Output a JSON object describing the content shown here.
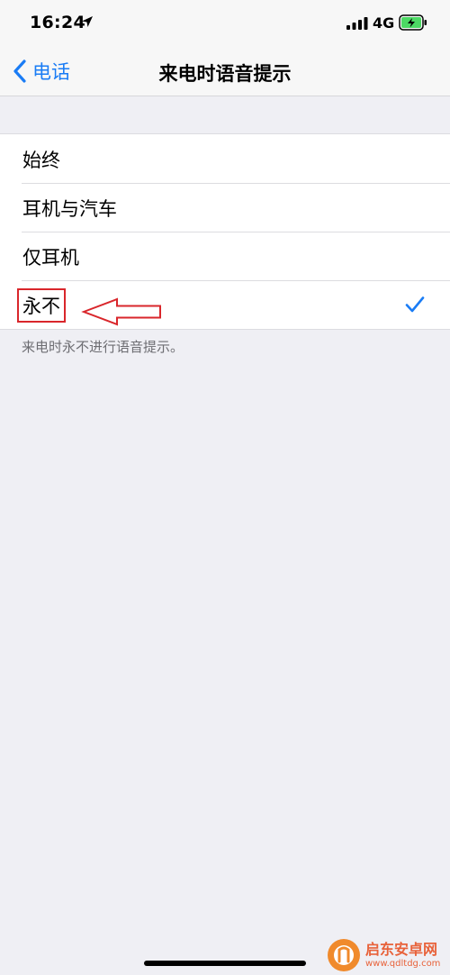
{
  "status_bar": {
    "time": "16:24",
    "network": "4G",
    "location_icon": "location-arrow-icon",
    "signal_icon": "cellular-signal-icon",
    "battery_icon": "battery-charging-icon"
  },
  "nav": {
    "back_label": "电话",
    "title": "来电时语音提示"
  },
  "options": [
    {
      "label": "始终",
      "selected": false
    },
    {
      "label": "耳机与汽车",
      "selected": false
    },
    {
      "label": "仅耳机",
      "selected": false
    },
    {
      "label": "永不",
      "selected": true
    }
  ],
  "footer_note": "来电时永不进行语音提示。",
  "watermark": {
    "title": "启东安卓网",
    "url": "www.qdltdg.com"
  },
  "colors": {
    "accent": "#1a7cf5",
    "annotation": "#d9262b",
    "battery": "#4cd964"
  }
}
